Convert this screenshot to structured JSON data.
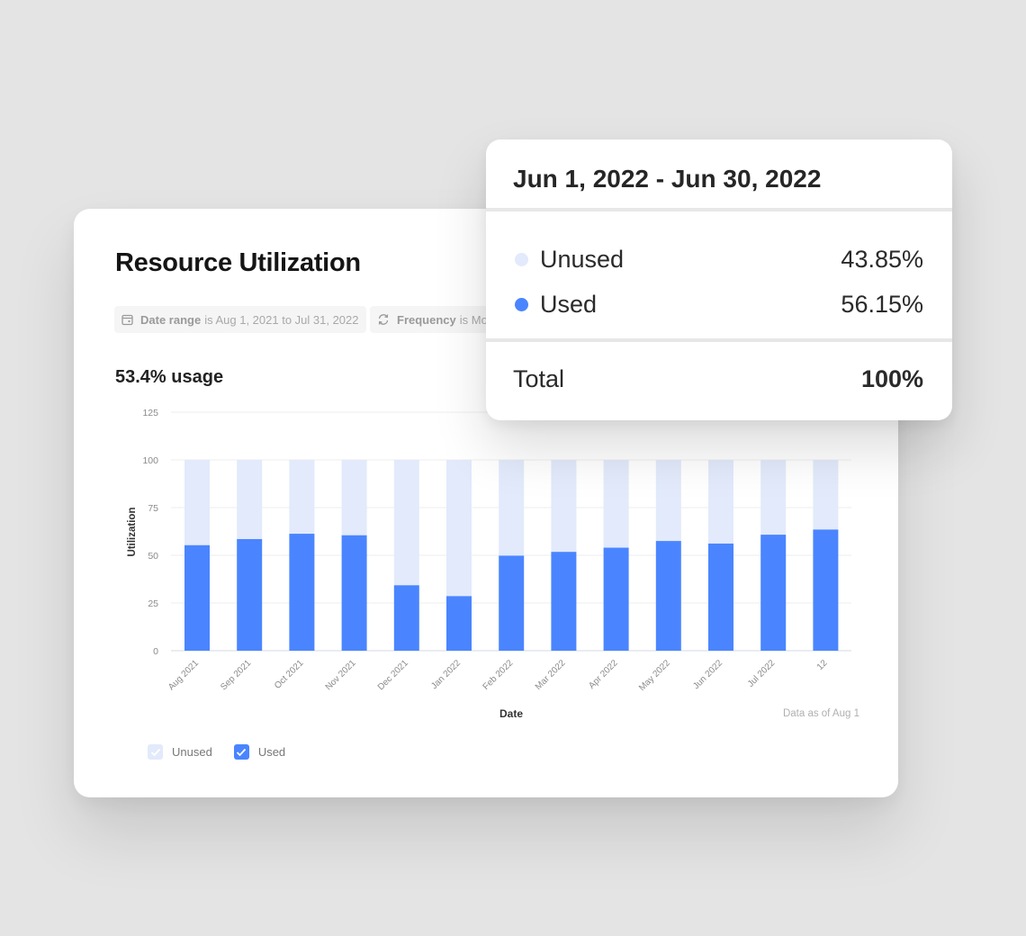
{
  "card": {
    "title": "Resource Utilization",
    "filters": {
      "date_range_label": "Date range",
      "date_range_value": "is Aug 1, 2021 to Jul 31, 2022",
      "frequency_label": "Frequency",
      "frequency_value": "is Mo"
    },
    "usage_summary": "53.4% usage",
    "data_as_of": "Data as of Aug 1",
    "legend": [
      {
        "label": "Unused",
        "color": "#e2eafb",
        "checked": true
      },
      {
        "label": "Used",
        "color": "#4a85ff",
        "checked": true
      }
    ]
  },
  "tooltip": {
    "period": "Jun 1, 2022 - Jun 30, 2022",
    "rows": [
      {
        "label": "Unused",
        "value": "43.85%",
        "color": "#e2eafb"
      },
      {
        "label": "Used",
        "value": "56.15%",
        "color": "#4a85ff"
      }
    ],
    "total_label": "Total",
    "total_value": "100%"
  },
  "chart_data": {
    "type": "bar",
    "stacked": true,
    "xlabel": "Date",
    "ylabel": "Utilization",
    "ylim": [
      0,
      125
    ],
    "yticks": [
      0,
      25,
      50,
      75,
      100,
      125
    ],
    "grid": true,
    "legend_position": "bottom-left",
    "categories": [
      "Aug 2021",
      "Sep 2021",
      "Oct 2021",
      "Nov 2021",
      "Dec 2021",
      "Jan 2022",
      "Feb 2022",
      "Mar 2022",
      "Apr 2022",
      "May 2022",
      "Jun 2022",
      "Jul 2022",
      "12"
    ],
    "series": [
      {
        "name": "Used",
        "color": "#4a85ff",
        "values": [
          55.3,
          58.5,
          61.3,
          60.5,
          34.3,
          28.6,
          49.8,
          51.8,
          54.0,
          57.5,
          56.15,
          60.8,
          63.5
        ]
      },
      {
        "name": "Unused",
        "color": "#e2eafb",
        "values": [
          44.7,
          41.5,
          38.7,
          39.5,
          65.7,
          71.4,
          50.2,
          48.2,
          46.0,
          42.5,
          43.85,
          39.2,
          36.5
        ]
      }
    ]
  }
}
